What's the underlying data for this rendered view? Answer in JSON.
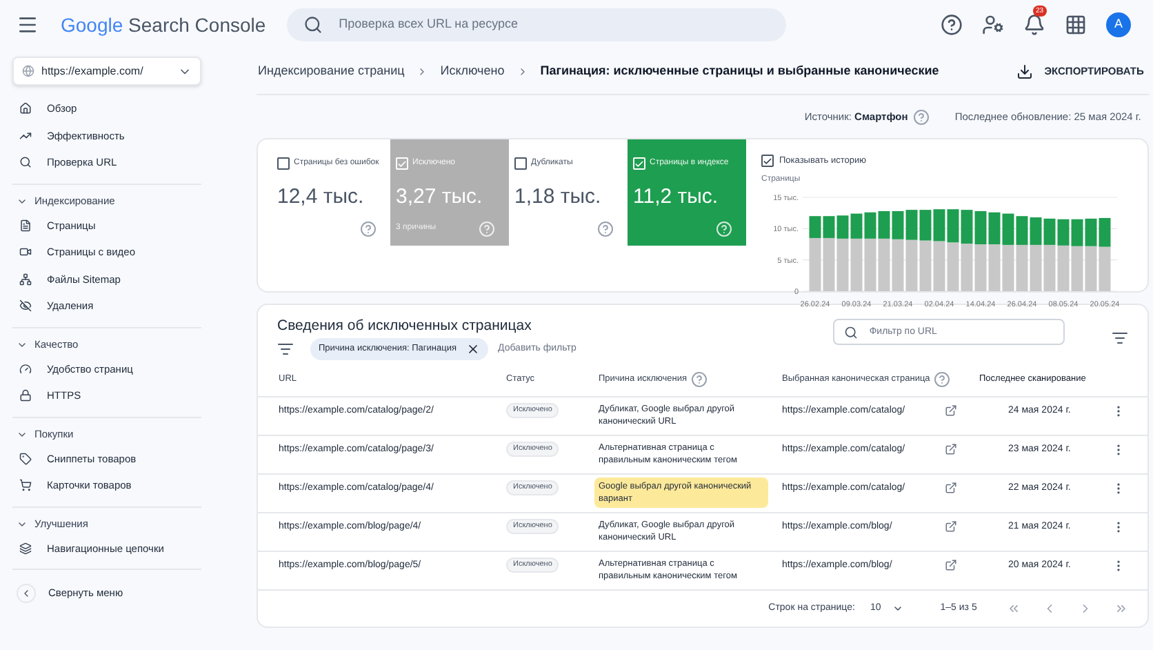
{
  "header": {
    "logo_google": "Google",
    "logo_product": "Search Console",
    "search_placeholder": "Проверка всех URL на ресурсе",
    "notifications": "23",
    "avatar": "A"
  },
  "sidebar": {
    "property": "https://example.com/",
    "sections": [
      {
        "items": [
          {
            "label": "Обзор"
          },
          {
            "label": "Эффективность"
          },
          {
            "label": "Проверка URL"
          }
        ]
      },
      {
        "title": "Индексирование",
        "expanded": true,
        "items": [
          {
            "label": "Страницы"
          },
          {
            "label": "Страницы с видео"
          },
          {
            "label": "Файлы Sitemap"
          },
          {
            "label": "Удаления"
          }
        ]
      },
      {
        "title": "Качество",
        "expanded": true,
        "items": [
          {
            "label": "Удобство страниц"
          },
          {
            "label": "HTTPS"
          }
        ]
      },
      {
        "title": "Покупки",
        "expanded": true,
        "items": [
          {
            "label": "Сниппеты товаров"
          },
          {
            "label": "Карточки товаров"
          }
        ]
      },
      {
        "title": "Улучшения",
        "expanded": true,
        "items": [
          {
            "label": "Навигационные цепочки"
          }
        ]
      }
    ],
    "collapse": "Свернуть меню"
  },
  "breadcrumbs": [
    "Индексирование страниц",
    "Исключено",
    "Пагинация: исключенные страницы и выбранные канонические"
  ],
  "export_button": "ЭКСПОРТИРОВАТЬ",
  "source": {
    "label": "Источник:",
    "value": "Смартфон"
  },
  "last_update": "Последнее обновление: 25 мая 2024 г.",
  "metrics": [
    {
      "label": "Страницы без ошибок",
      "value": "12,4 тыс.",
      "selected": false
    },
    {
      "label": "Исключено",
      "value": "3,27 тыс.",
      "sub": "3 причины",
      "selected": true,
      "color": "#b0b0b0"
    },
    {
      "label": "Дубликаты",
      "value": "1,18 тыс.",
      "selected": false
    },
    {
      "label": "Страницы в индексе",
      "value": "11,2 тыс.",
      "selected": true,
      "color": "#1e9e50"
    }
  ],
  "history": {
    "label": "Показывать историю",
    "checked": true,
    "chart_data": {
      "type": "bar",
      "stacked": true,
      "ylabel": "Страницы",
      "categories": [
        "26.02.24",
        null,
        null,
        "09.03.24",
        null,
        null,
        "21.03.24",
        null,
        null,
        "02.04.24",
        null,
        null,
        "14.04.24",
        null,
        null,
        "26.04.24",
        null,
        null,
        "08.05.24",
        null,
        null,
        "20.05.24"
      ],
      "series": [
        {
          "color": "#c8c8c8",
          "values": [
            8.5,
            8.5,
            8.4,
            8.4,
            8.4,
            8.4,
            8.3,
            8.2,
            8.1,
            8.0,
            7.8,
            7.6,
            7.5,
            7.5,
            7.4,
            7.4,
            7.4,
            7.4,
            7.3,
            7.2,
            7.2,
            7.1
          ]
        },
        {
          "color": "#1e9e50",
          "values": [
            3.5,
            3.5,
            3.7,
            4.0,
            4.2,
            4.4,
            4.5,
            4.8,
            4.9,
            5.1,
            5.3,
            5.4,
            5.3,
            5.1,
            5.0,
            4.6,
            4.4,
            4.2,
            4.2,
            4.3,
            4.4,
            4.6
          ]
        }
      ],
      "ylim": [
        0,
        15
      ],
      "yticks": [
        {
          "value": 0,
          "label": "0"
        },
        {
          "value": 5,
          "label": "5 тыс."
        },
        {
          "value": 10,
          "label": "10 тыс."
        },
        {
          "value": 15,
          "label": "15 тыс."
        }
      ]
    }
  },
  "table": {
    "title": "Сведения об исключенных страницах",
    "filter_chip": "Причина исключения: Пагинация",
    "add_filter": "Добавить фильтр",
    "search_placeholder": "Фильтр по URL",
    "columns": [
      "URL",
      "Статус",
      "Причина исключения",
      "Выбранная каноническая страница",
      "Последнее сканирование"
    ],
    "rows": [
      {
        "url": "https://example.com/catalog/page/2/",
        "status": "Исключено",
        "reason": "Дубликат, Google выбрал другой канонический URL",
        "highlighted": false,
        "canonical": "https://example.com/catalog/",
        "last_crawl": "24 мая 2024 г."
      },
      {
        "url": "https://example.com/catalog/page/3/",
        "status": "Исключено",
        "reason": "Альтернативная страница с правильным каноническим тегом",
        "highlighted": false,
        "canonical": "https://example.com/catalog/",
        "last_crawl": "23 мая 2024 г."
      },
      {
        "url": "https://example.com/catalog/page/4/",
        "status": "Исключено",
        "reason": "Google выбрал другой канонический вариант",
        "highlighted": true,
        "canonical": "https://example.com/catalog/",
        "last_crawl": "22 мая 2024 г."
      },
      {
        "url": "https://example.com/blog/page/4/",
        "status": "Исключено",
        "reason": "Дубликат, Google выбрал другой канонический URL",
        "highlighted": false,
        "canonical": "https://example.com/blog/",
        "last_crawl": "21 мая 2024 г."
      },
      {
        "url": "https://example.com/blog/page/5/",
        "status": "Исключено",
        "reason": "Альтернативная страница с правильным каноническим тегом",
        "highlighted": false,
        "canonical": "https://example.com/blog/",
        "last_crawl": "20 мая 2024 г."
      }
    ],
    "pagination": {
      "rows_label": "Строк на странице:",
      "rows_value": "10",
      "range": "1–5 из 5"
    }
  }
}
